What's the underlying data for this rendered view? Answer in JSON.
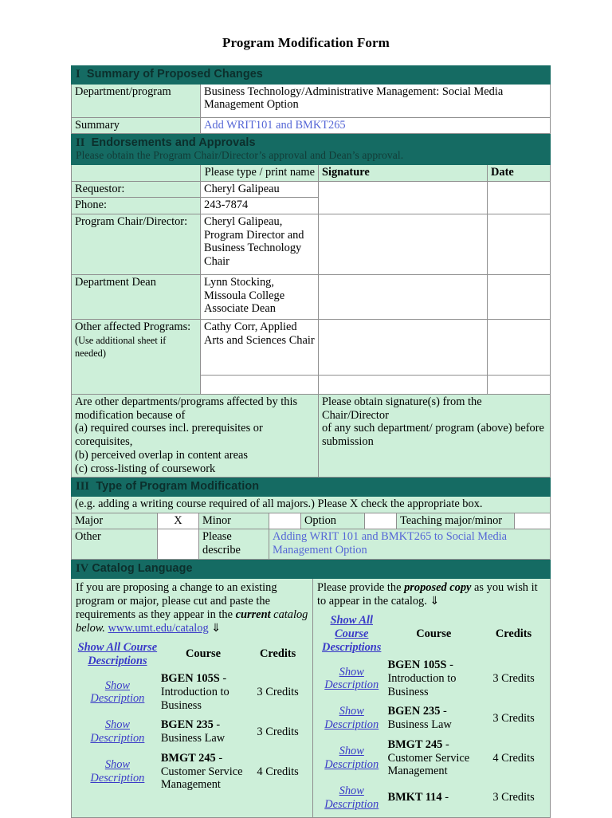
{
  "document": {
    "title": "Program Modification Form"
  },
  "section_1": {
    "number": "I",
    "heading": "Summary of Proposed Changes",
    "rows": [
      {
        "label": "Department/program",
        "value": "Business Technology/Administrative Management: Social Media Management Option",
        "value_is_link": false
      },
      {
        "label": "Summary",
        "value": "Add WRIT101 and BMKT265",
        "value_is_link": true
      }
    ]
  },
  "section_2": {
    "number": "II",
    "heading": "Endorsements and Approvals",
    "subheading": "Please obtain the Program Chair/Director’s approval and Dean’s approval.",
    "column_headers": {
      "name": "Please type / print name",
      "signature": "Signature",
      "date": "Date"
    },
    "rows": [
      {
        "label": "Requestor:",
        "name": "Cheryl Galipeau"
      },
      {
        "label": "Phone:",
        "name": "243-7874"
      },
      {
        "label": "Program Chair/Director:",
        "name": "Cheryl Galipeau, Program Director and Business Technology Chair"
      },
      {
        "label": "Department Dean",
        "name": "Lynn Stocking, Missoula College Associate Dean"
      },
      {
        "label": "Other affected Programs:",
        "label_note": "(Use additional sheet if needed)",
        "name": "Cathy Corr, Applied Arts and Sciences Chair"
      },
      {
        "label": "",
        "name": ""
      }
    ],
    "footer_left": "Are other departments/programs affected by this modification because of\n(a) required courses incl. prerequisites or corequisites,\n(b) perceived overlap in content areas\n(c) cross-listing of coursework",
    "footer_left_lines": [
      "Are other departments/programs affected by this",
      "modification because of",
      "(a) required courses incl. prerequisites or",
      "corequisites,",
      "(b) perceived overlap in content areas",
      "(c) cross-listing of coursework"
    ],
    "footer_right_lines": [
      "Please obtain signature(s) from the Chair/Director",
      "of any such department/ program (above) before",
      "submission"
    ]
  },
  "section_3": {
    "number": "III",
    "heading": "Type of Program Modification",
    "instruction": "(e.g. adding a writing course required of all majors.) Please X check the appropriate box.",
    "checkboxes": [
      {
        "label": "Major",
        "value": "X"
      },
      {
        "label": "Minor",
        "value": ""
      },
      {
        "label": "Option",
        "value": ""
      },
      {
        "label": "Teaching major/minor",
        "value": ""
      }
    ],
    "other_label": "Other",
    "other_value": "",
    "describe_label": "Please describe",
    "describe_value": "Adding WRIT 101 and BMKT265 to Social Media Management Option"
  },
  "section_4": {
    "number": "IV",
    "heading": "Catalog Language",
    "left": {
      "intro_pre": "If you are proposing a change to an existing program or major, please cut and paste the requirements as they appear in the ",
      "intro_em": "current",
      "intro_mid": " catalog below.",
      "catalog_link": "www.umt.edu/catalog",
      "arrow": "⇓",
      "show_all_link": "Show All Course Descriptions",
      "col_course": "Course",
      "col_credits": "Credits",
      "link_label": "Show Description",
      "courses": [
        {
          "code": "BGEN 105S",
          "name": "- Introduction to Business",
          "credits": "3 Credits"
        },
        {
          "code": "BGEN 235",
          "name": "- Business Law",
          "credits": "3 Credits"
        },
        {
          "code": "BMGT 245",
          "name": "- Customer Service Management",
          "credits": "4 Credits"
        }
      ]
    },
    "right": {
      "intro_pre": "Please provide the ",
      "intro_em": "proposed copy",
      "intro_post": " as you wish it to appear in the catalog. ",
      "arrow": "⇓",
      "show_all_link": "Show All Course Descriptions",
      "col_course": "Course",
      "col_credits": "Credits",
      "link_label": "Show Description",
      "courses": [
        {
          "code": "BGEN 105S",
          "name": "- Introduction to Business",
          "credits": "3 Credits"
        },
        {
          "code": "BGEN 235",
          "name": "- Business Law",
          "credits": "3 Credits"
        },
        {
          "code": "BMGT 245",
          "name": "- Customer Service Management",
          "credits": "4 Credits"
        },
        {
          "code": "BMKT 114",
          "name": "-",
          "credits": "3 Credits"
        }
      ]
    }
  },
  "colors": {
    "section_header_bg": "#156b63",
    "cell_green": "#cdefd9",
    "link_blue": "#3a3ac8",
    "body_text": "#000000"
  }
}
